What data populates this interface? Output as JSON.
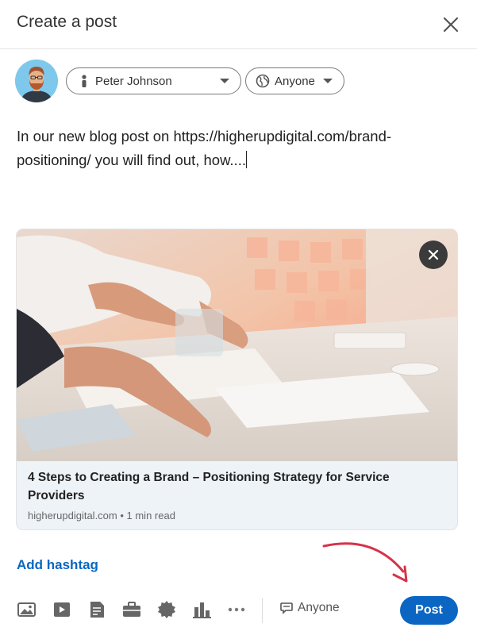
{
  "dialog": {
    "title": "Create a post"
  },
  "author": {
    "name": "Peter Johnson"
  },
  "audience": {
    "label": "Anyone"
  },
  "post": {
    "text": "In our new blog post on https://higherupdigital.com/brand-positioning/ you will find out, how...."
  },
  "link_preview": {
    "title": "4 Steps to Creating a Brand – Positioning Strategy for Service Providers",
    "meta": "higherupdigital.com • 1 min read"
  },
  "add_hashtag": "Add hashtag",
  "toolbar": {
    "icons": [
      "photo-icon",
      "video-icon",
      "document-icon",
      "job-icon",
      "celebrate-icon",
      "poll-icon",
      "more-icon"
    ],
    "comment_scope": "Anyone",
    "post_label": "Post"
  },
  "colors": {
    "accent": "#0a66c2",
    "annotation_arrow": "#d6334a"
  }
}
